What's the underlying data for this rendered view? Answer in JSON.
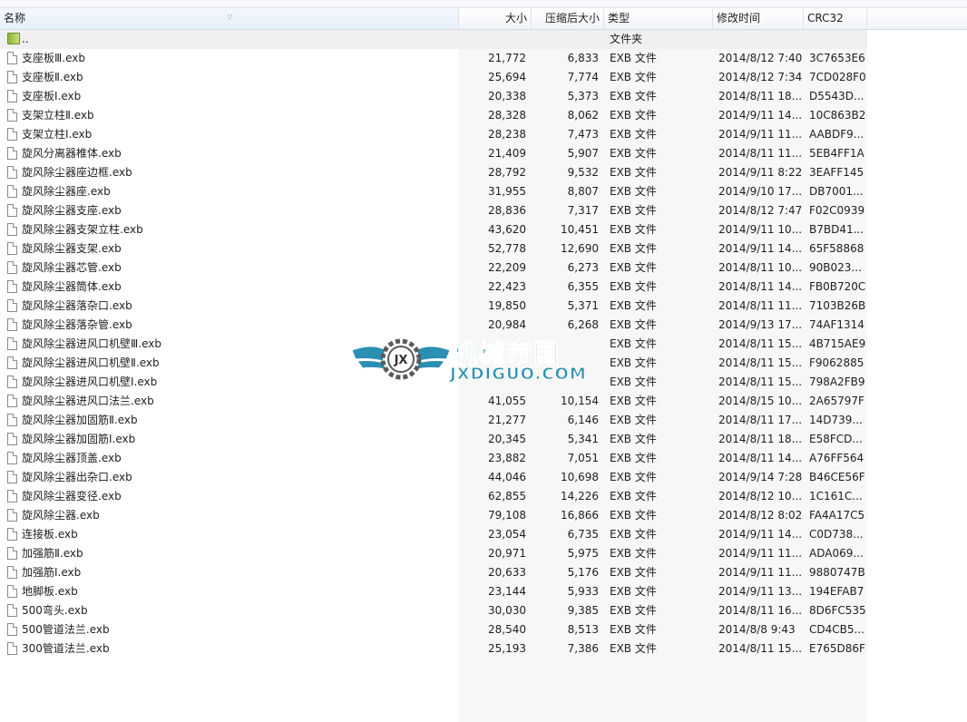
{
  "columns": {
    "name": "名称",
    "size": "大小",
    "packed": "压缩后大小",
    "type": "类型",
    "modified": "修改时间",
    "crc": "CRC32"
  },
  "parent_row": {
    "name": "..",
    "type": "文件夹"
  },
  "files": [
    {
      "name": "支座板Ⅲ.exb",
      "size": "21,772",
      "packed": "6,833",
      "type": "EXB 文件",
      "modified": "2014/8/12 7:40",
      "crc": "3C7653E6"
    },
    {
      "name": "支座板Ⅱ.exb",
      "size": "25,694",
      "packed": "7,774",
      "type": "EXB 文件",
      "modified": "2014/8/12 7:34",
      "crc": "7CD028F0"
    },
    {
      "name": "支座板Ⅰ.exb",
      "size": "20,338",
      "packed": "5,373",
      "type": "EXB 文件",
      "modified": "2014/8/11 18...",
      "crc": "D5543D..."
    },
    {
      "name": "支架立柱Ⅱ.exb",
      "size": "28,328",
      "packed": "8,062",
      "type": "EXB 文件",
      "modified": "2014/9/11 14...",
      "crc": "10C863B2"
    },
    {
      "name": "支架立柱Ⅰ.exb",
      "size": "28,238",
      "packed": "7,473",
      "type": "EXB 文件",
      "modified": "2014/9/11 11...",
      "crc": "AABDF9..."
    },
    {
      "name": "旋风分离器椎体.exb",
      "size": "21,409",
      "packed": "5,907",
      "type": "EXB 文件",
      "modified": "2014/8/11 11...",
      "crc": "5EB4FF1A"
    },
    {
      "name": "旋风除尘器座边框.exb",
      "size": "28,792",
      "packed": "9,532",
      "type": "EXB 文件",
      "modified": "2014/9/11 8:22",
      "crc": "3EAFF145"
    },
    {
      "name": "旋风除尘器座.exb",
      "size": "31,955",
      "packed": "8,807",
      "type": "EXB 文件",
      "modified": "2014/9/10 17...",
      "crc": "DB7001..."
    },
    {
      "name": "旋风除尘器支座.exb",
      "size": "28,836",
      "packed": "7,317",
      "type": "EXB 文件",
      "modified": "2014/8/12 7:47",
      "crc": "F02C0939"
    },
    {
      "name": "旋风除尘器支架立柱.exb",
      "size": "43,620",
      "packed": "10,451",
      "type": "EXB 文件",
      "modified": "2014/9/11 10...",
      "crc": "B7BD41..."
    },
    {
      "name": "旋风除尘器支架.exb",
      "size": "52,778",
      "packed": "12,690",
      "type": "EXB 文件",
      "modified": "2014/9/11 14...",
      "crc": "65F58868"
    },
    {
      "name": "旋风除尘器芯管.exb",
      "size": "22,209",
      "packed": "6,273",
      "type": "EXB 文件",
      "modified": "2014/8/11 10...",
      "crc": "90B023..."
    },
    {
      "name": "旋风除尘器筒体.exb",
      "size": "22,423",
      "packed": "6,355",
      "type": "EXB 文件",
      "modified": "2014/8/11 14...",
      "crc": "FB0B720C"
    },
    {
      "name": "旋风除尘器落杂口.exb",
      "size": "19,850",
      "packed": "5,371",
      "type": "EXB 文件",
      "modified": "2014/8/11 11...",
      "crc": "7103B26B"
    },
    {
      "name": "旋风除尘器落杂管.exb",
      "size": "20,984",
      "packed": "6,268",
      "type": "EXB 文件",
      "modified": "2014/9/13 17...",
      "crc": "74AF1314"
    },
    {
      "name": "旋风除尘器进风口机壁Ⅲ.exb",
      "size": "",
      "packed": "",
      "type": "EXB 文件",
      "modified": "2014/8/11 15...",
      "crc": "4B715AE9"
    },
    {
      "name": "旋风除尘器进风口机壁Ⅱ.exb",
      "size": "",
      "packed": "",
      "type": "EXB 文件",
      "modified": "2014/8/11 15...",
      "crc": "F9062885"
    },
    {
      "name": "旋风除尘器进风口机壁Ⅰ.exb",
      "size": "",
      "packed": "",
      "type": "EXB 文件",
      "modified": "2014/8/11 15...",
      "crc": "798A2FB9"
    },
    {
      "name": "旋风除尘器进风口法兰.exb",
      "size": "41,055",
      "packed": "10,154",
      "type": "EXB 文件",
      "modified": "2014/8/15 10...",
      "crc": "2A65797F"
    },
    {
      "name": "旋风除尘器加固筋Ⅱ.exb",
      "size": "21,277",
      "packed": "6,146",
      "type": "EXB 文件",
      "modified": "2014/8/11 17...",
      "crc": "14D739..."
    },
    {
      "name": "旋风除尘器加固筋Ⅰ.exb",
      "size": "20,345",
      "packed": "5,341",
      "type": "EXB 文件",
      "modified": "2014/8/11 18...",
      "crc": "E58FCD..."
    },
    {
      "name": "旋风除尘器顶盖.exb",
      "size": "23,882",
      "packed": "7,051",
      "type": "EXB 文件",
      "modified": "2014/8/11 14...",
      "crc": "A76FF564"
    },
    {
      "name": "旋风除尘器出杂口.exb",
      "size": "44,046",
      "packed": "10,698",
      "type": "EXB 文件",
      "modified": "2014/9/14 7:28",
      "crc": "B46CE56F"
    },
    {
      "name": "旋风除尘器变径.exb",
      "size": "62,855",
      "packed": "14,226",
      "type": "EXB 文件",
      "modified": "2014/8/12 10...",
      "crc": "1C161C..."
    },
    {
      "name": "旋风除尘器.exb",
      "size": "79,108",
      "packed": "16,866",
      "type": "EXB 文件",
      "modified": "2014/8/12 8:02",
      "crc": "FA4A17C5"
    },
    {
      "name": "连接板.exb",
      "size": "23,054",
      "packed": "6,735",
      "type": "EXB 文件",
      "modified": "2014/9/11 14...",
      "crc": "C0D738..."
    },
    {
      "name": "加强筋Ⅱ.exb",
      "size": "20,971",
      "packed": "5,975",
      "type": "EXB 文件",
      "modified": "2014/9/11 11...",
      "crc": "ADA069..."
    },
    {
      "name": "加强筋Ⅰ.exb",
      "size": "20,633",
      "packed": "5,176",
      "type": "EXB 文件",
      "modified": "2014/9/11 11...",
      "crc": "9880747B"
    },
    {
      "name": "地脚板.exb",
      "size": "23,144",
      "packed": "5,933",
      "type": "EXB 文件",
      "modified": "2014/9/11 13...",
      "crc": "194EFAB7"
    },
    {
      "name": "500弯头.exb",
      "size": "30,030",
      "packed": "9,385",
      "type": "EXB 文件",
      "modified": "2014/8/11 16...",
      "crc": "8D6FC535"
    },
    {
      "name": "500管道法兰.exb",
      "size": "28,540",
      "packed": "8,513",
      "type": "EXB 文件",
      "modified": "2014/8/8 9:43",
      "crc": "CD4CB5..."
    },
    {
      "name": "300管道法兰.exb",
      "size": "25,193",
      "packed": "7,386",
      "type": "EXB 文件",
      "modified": "2014/8/11 15...",
      "crc": "E765D86F"
    }
  ],
  "watermark": {
    "title": "机械帝国",
    "url": "JXDIGUO.COM",
    "badge": "JX"
  },
  "colors": {
    "watermark": "#2a8fb3",
    "header_bg": "#f1f4f8",
    "parent_row_bg": "#f0f0f0"
  }
}
